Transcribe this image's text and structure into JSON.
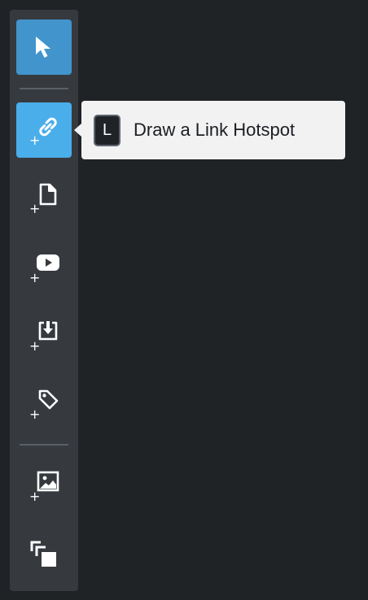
{
  "toolbar": {
    "tools": [
      {
        "id": "select",
        "icon": "cursor-arrow-icon",
        "active": true
      },
      {
        "id": "link-hotspot",
        "icon": "link-icon",
        "active": true,
        "has_plus": true
      },
      {
        "id": "page-hotspot",
        "icon": "document-icon",
        "has_plus": true
      },
      {
        "id": "video-hotspot",
        "icon": "youtube-play-icon",
        "has_plus": true
      },
      {
        "id": "download-hotspot",
        "icon": "download-tray-icon",
        "has_plus": true
      },
      {
        "id": "tag-hotspot",
        "icon": "tag-icon",
        "has_plus": true
      },
      {
        "id": "image-hotspot",
        "icon": "image-icon",
        "has_plus": true
      },
      {
        "id": "layers",
        "icon": "stacked-squares-icon"
      }
    ],
    "plus_glyph": "+"
  },
  "tooltip": {
    "shortcut_key": "L",
    "text": "Draw a Link Hotspot"
  },
  "colors": {
    "background": "#202326",
    "toolbar": "#363a3f",
    "select_active": "#4294cc",
    "link_active": "#4aaeea",
    "tooltip_bg": "#f2f2f3"
  }
}
